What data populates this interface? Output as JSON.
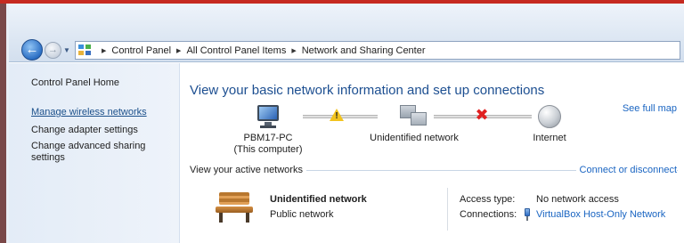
{
  "address_bar": {
    "crumbs": [
      "Control Panel",
      "All Control Panel Items",
      "Network and Sharing Center"
    ]
  },
  "sidebar": {
    "home": "Control Panel Home",
    "items": [
      "Manage wireless networks",
      "Change adapter settings",
      "Change advanced sharing settings"
    ]
  },
  "main": {
    "title": "View your basic network information and set up connections",
    "see_full_map": "See full map",
    "network_map": {
      "computer_name": "PBM17-PC",
      "computer_note": "(This computer)",
      "network": "Unidentified network",
      "internet": "Internet",
      "link1_status": "warning",
      "link2_status": "disconnected"
    },
    "active_networks_label": "View your active networks",
    "connect_link": "Connect or disconnect",
    "active_network": {
      "name": "Unidentified network",
      "category": "Public network",
      "access_type_label": "Access type:",
      "access_type_value": "No network access",
      "connections_label": "Connections:",
      "connections_value": "VirtualBox Host-Only Network"
    }
  },
  "colors": {
    "title_blue": "#1d4f91",
    "link_blue": "#1a65c2",
    "warning_yellow": "#f2c31e",
    "error_red": "#e02020",
    "top_bar_red": "#c62a20"
  },
  "icons": {
    "back": "back-arrow-icon",
    "forward": "forward-arrow-icon",
    "address": "control-panel-icon",
    "computer": "computer-monitor-icon",
    "network": "network-computers-icon",
    "internet": "globe-icon",
    "link_warning": "warning-icon",
    "link_error": "red-x-icon",
    "active_network": "bench-icon",
    "adapter": "network-adapter-icon"
  }
}
